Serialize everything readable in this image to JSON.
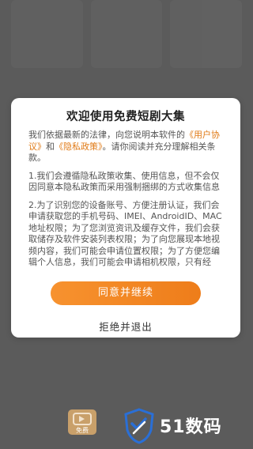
{
  "dialog": {
    "title": "欢迎使用免费短剧大集",
    "intro_before": "我们依据最新的法律，向您说明本软件的",
    "user_agreement": "《用户协议》",
    "and": "和",
    "privacy_policy": "《隐私政策》",
    "intro_after": "。请你阅读并充分理解相关条款。",
    "para1": "1.我们会遵循隐私政策收集、使用信息，但不会仅因同意本隐私政策而采用强制捆绑的方式收集信息",
    "para2": "2.为了识别您的设备账号、方便注册认证，我们会申请获取您的手机号码、IMEI、AndroidID、MAC地址权限；为了您浏览资讯及缓存文件，我们会获取储存及软件安装列表权限；为了向您展现本地视频内容，我们可能会申请位置权限；为了方便您编辑个人信息，我们可能会申请相机权限，只有经",
    "agree_label": "同意并继续",
    "reject_label": "拒绝并退出"
  },
  "bottom_nav": {
    "label": "免费"
  },
  "watermark": {
    "text": "51数码"
  },
  "colors": {
    "accent": "#ee7d1a",
    "link": "#e07a16",
    "overlay": "#707070"
  }
}
